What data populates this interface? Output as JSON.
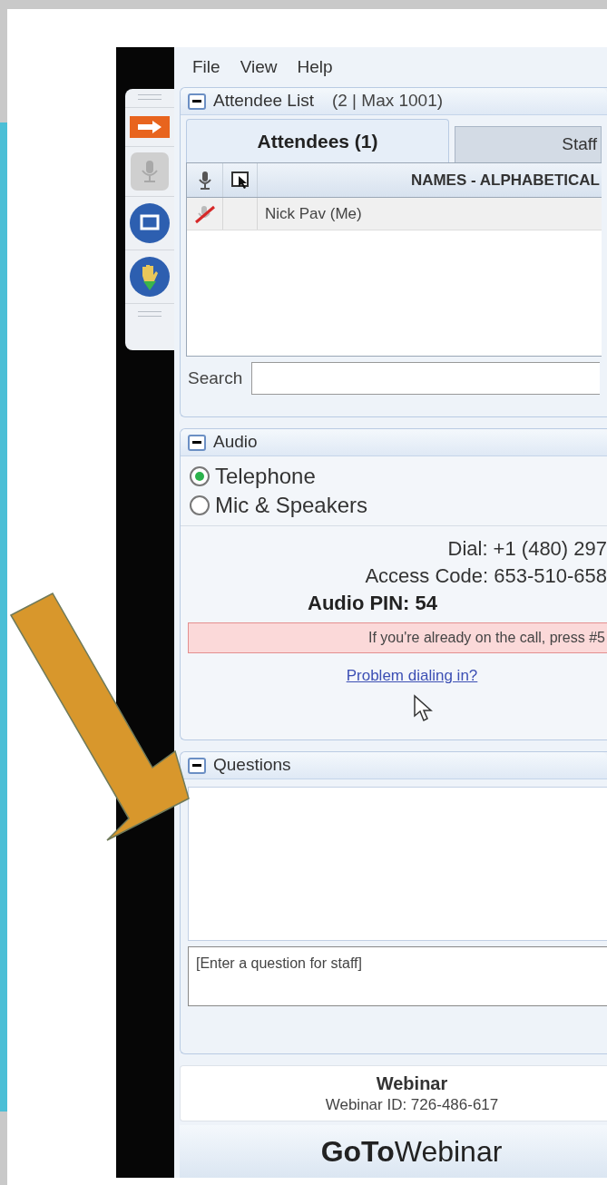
{
  "menu": [
    "File",
    "View",
    "Help"
  ],
  "attendee_list": {
    "title": "Attendee List",
    "count": "(2 | Max 1001)",
    "tabs": [
      {
        "label": "Attendees (1)",
        "selected": true
      },
      {
        "label": "Staff",
        "selected": false
      }
    ],
    "table": {
      "column_3": "NAMES - ALPHABETICAL",
      "rows": [
        {
          "name": "Nick Pav (Me)"
        }
      ]
    },
    "search": {
      "label": "Search"
    }
  },
  "audio": {
    "title": "Audio",
    "options": [
      {
        "label": "Telephone",
        "selected": true
      },
      {
        "label": "Mic & Speakers",
        "selected": false
      }
    ],
    "dial": "Dial: +1 (480) 297",
    "access_code": "Access Code: 653-510-658",
    "pin": "Audio PIN: 54",
    "notice": "If you're already on the call, press #5",
    "link": "Problem dialing in?"
  },
  "questions": {
    "title": "Questions",
    "placeholder": "[Enter a question for staff]"
  },
  "footer": {
    "title": "Webinar",
    "id": "Webinar ID: 726-486-617",
    "logo": "**GoTo**Webinar"
  }
}
